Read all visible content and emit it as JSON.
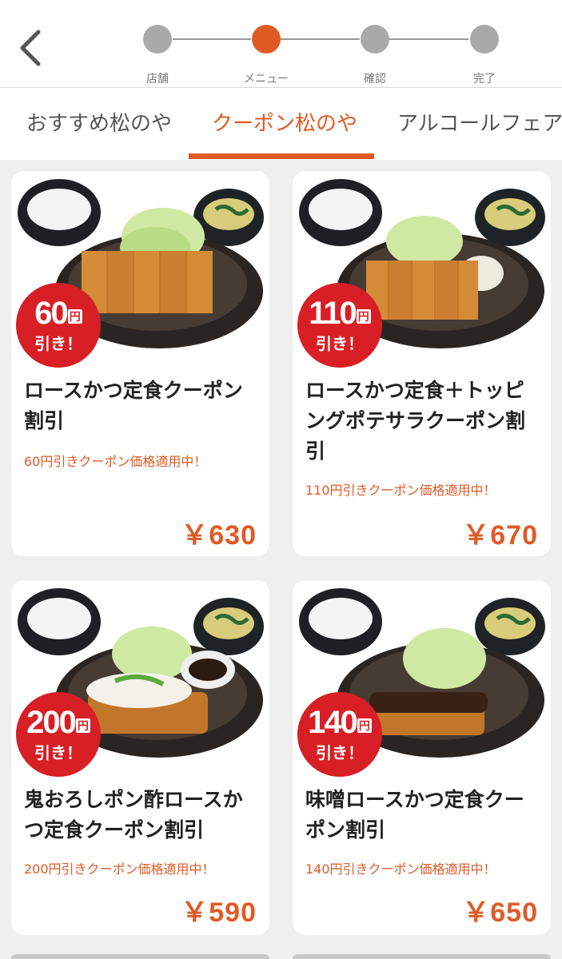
{
  "stepper": {
    "steps": [
      {
        "label": "店舗"
      },
      {
        "label": "メニュー"
      },
      {
        "label": "確認"
      },
      {
        "label": "完了"
      }
    ],
    "active_index": 1,
    "active_color": "#e05a26",
    "inactive_color": "#a9a9a9"
  },
  "tabs": [
    {
      "label": "おすすめ松のや"
    },
    {
      "label": "クーポン松のや"
    },
    {
      "label": "アルコールフェア"
    }
  ],
  "active_tab": 1,
  "menu_items": [
    {
      "badge_amount": "60",
      "badge_yen": "円",
      "badge_off": "引き！",
      "name": "ロースかつ定食クーポン割引",
      "coupon_note": "60円引きクーポン価格適用中！",
      "price": "￥630"
    },
    {
      "badge_amount": "110",
      "badge_yen": "円",
      "badge_off": "引き！",
      "name": "ロースかつ定食＋トッピングポテサラクーポン割引",
      "coupon_note": "110円引きクーポン価格適用中！",
      "price": "￥670"
    },
    {
      "badge_amount": "200",
      "badge_yen": "円",
      "badge_off": "引き！",
      "name": "鬼おろしポン酢ロースかつ定食クーポン割引",
      "coupon_note": "200円引きクーポン価格適用中！",
      "price": "￥590"
    },
    {
      "badge_amount": "140",
      "badge_yen": "円",
      "badge_off": "引き！",
      "name": "味噌ロースかつ定食クーポン割引",
      "coupon_note": "140円引きクーポン価格適用中！",
      "price": "￥650"
    }
  ],
  "icons": {
    "back": "chevron-left-icon"
  },
  "colors": {
    "accent": "#e05a26",
    "badge_red": "#d81f25"
  }
}
